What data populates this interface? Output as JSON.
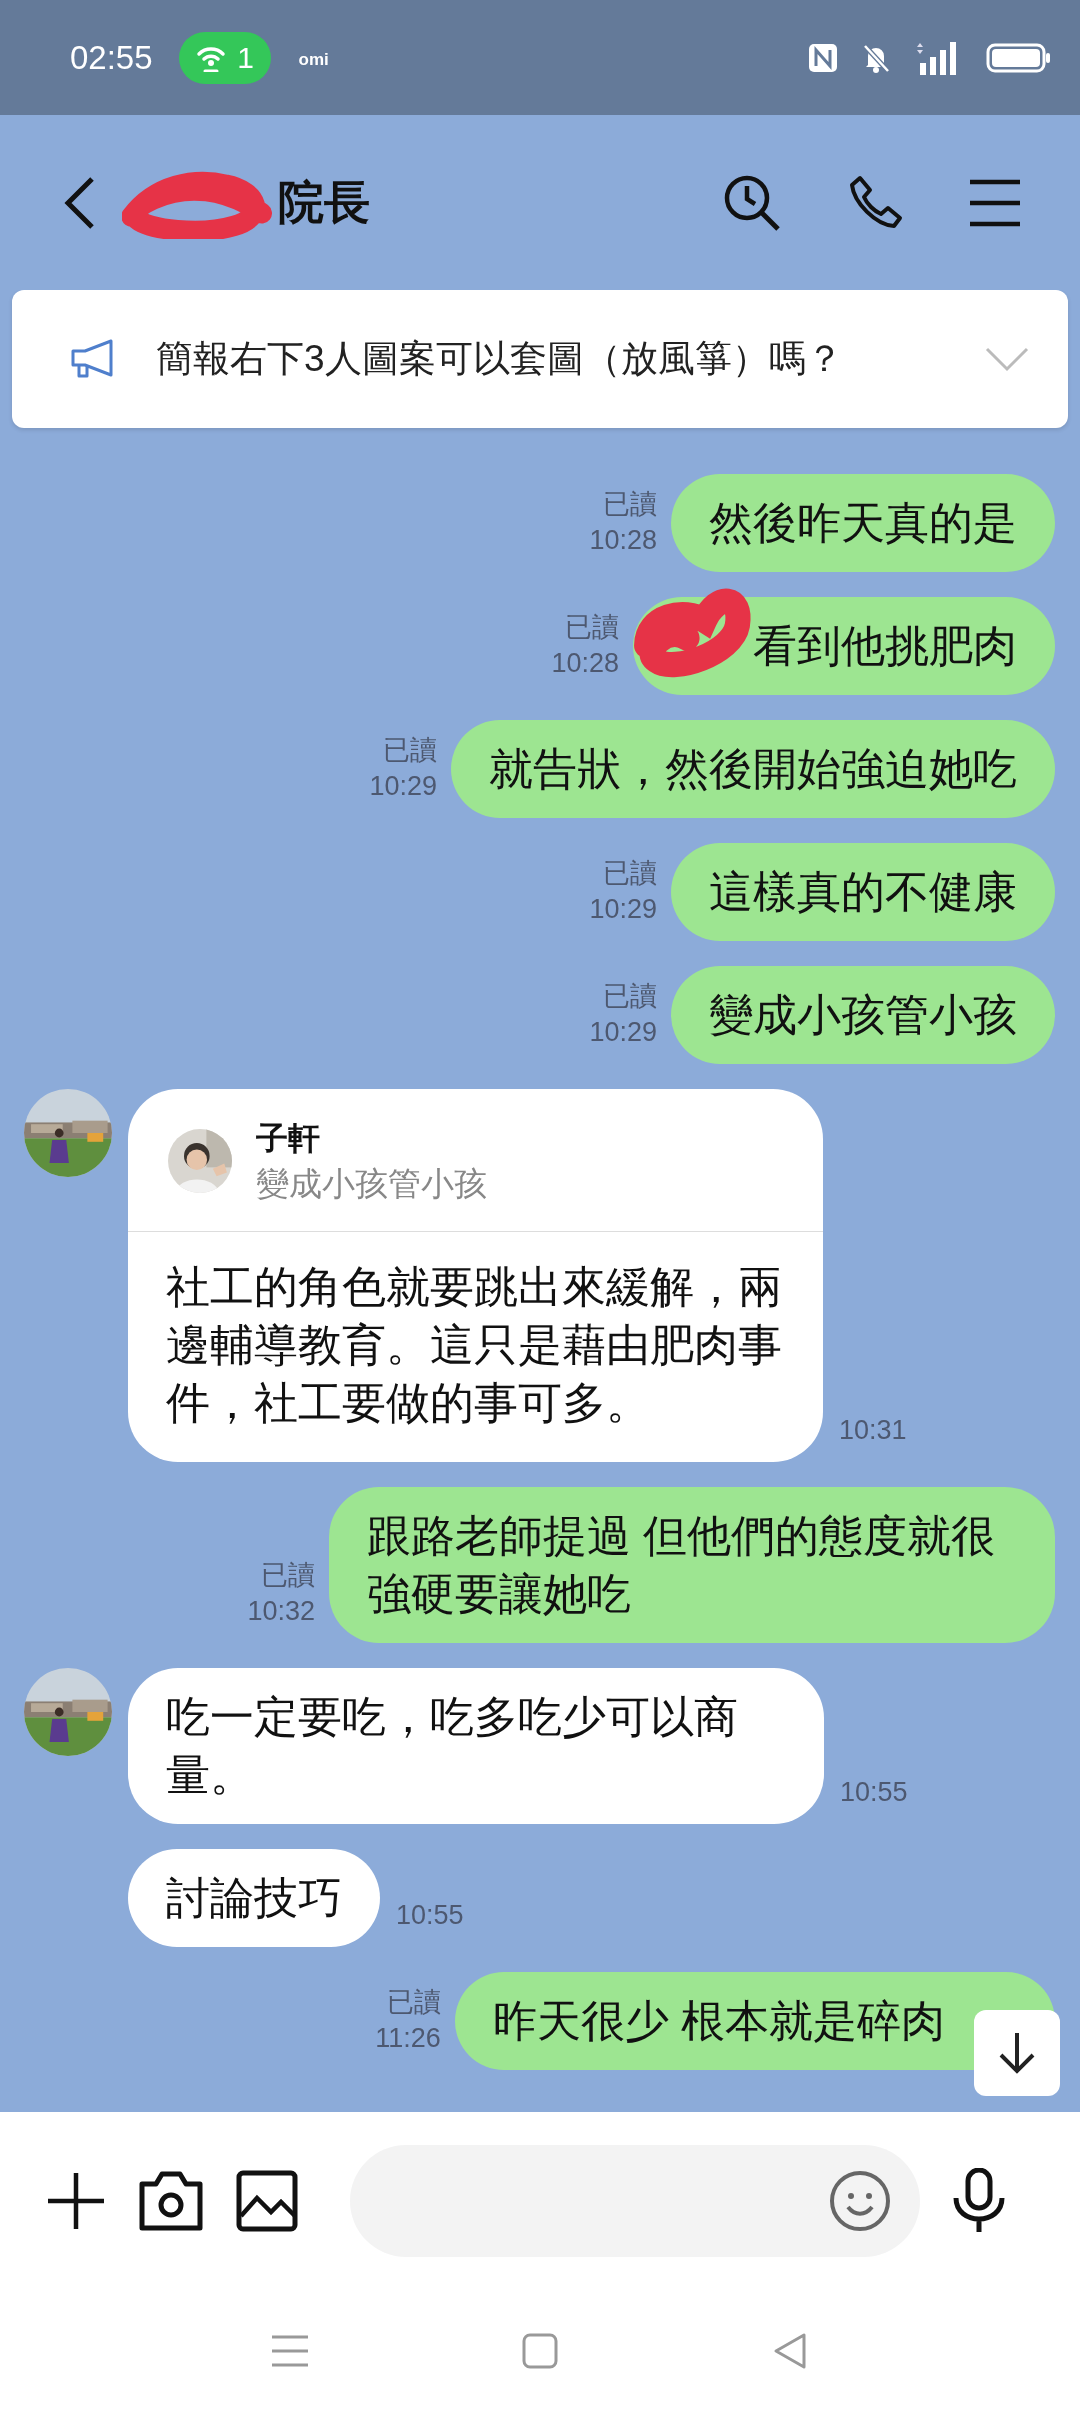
{
  "status_bar": {
    "time": "02:55",
    "hotspot_count": "1",
    "carrier": "omi"
  },
  "header": {
    "title": "院長",
    "title_redacted": true
  },
  "announcement": {
    "text": "簡報右下3人圖案可以套圖（放風箏）嗎？"
  },
  "messages": [
    {
      "kind": "sent",
      "text": "然後昨天真的是",
      "read": "已讀",
      "time": "10:28",
      "redacted": false
    },
    {
      "kind": "sent",
      "text": "看到他挑肥肉",
      "read": "已讀",
      "time": "10:28",
      "redacted": true
    },
    {
      "kind": "sent",
      "text": "就告狀，然後開始強迫她吃",
      "read": "已讀",
      "time": "10:29",
      "redacted": false
    },
    {
      "kind": "sent",
      "text": "這樣真的不健康",
      "read": "已讀",
      "time": "10:29",
      "redacted": false
    },
    {
      "kind": "sent",
      "text": "變成小孩管小孩",
      "read": "已讀",
      "time": "10:29",
      "redacted": false
    },
    {
      "kind": "received",
      "show_avatar": true,
      "quote": {
        "name": "子軒",
        "text": "變成小孩管小孩"
      },
      "text": "社工的角色就要跳出來緩解，兩邊輔導教育。這只是藉由肥肉事件，社工要做的事可多。",
      "time": "10:31"
    },
    {
      "kind": "sent",
      "text": "跟路老師提過 但他們的態度就很強硬要讓她吃",
      "read": "已讀",
      "time": "10:32",
      "redacted": false
    },
    {
      "kind": "received",
      "show_avatar": true,
      "text": "吃一定要吃，吃多吃少可以商量。",
      "time": "10:55"
    },
    {
      "kind": "received",
      "show_avatar": false,
      "text": "討論技巧",
      "time": "10:55"
    },
    {
      "kind": "sent",
      "text": "昨天很少 根本就是碎肉",
      "read": "已讀",
      "time": "11:26",
      "redacted": false
    }
  ]
}
